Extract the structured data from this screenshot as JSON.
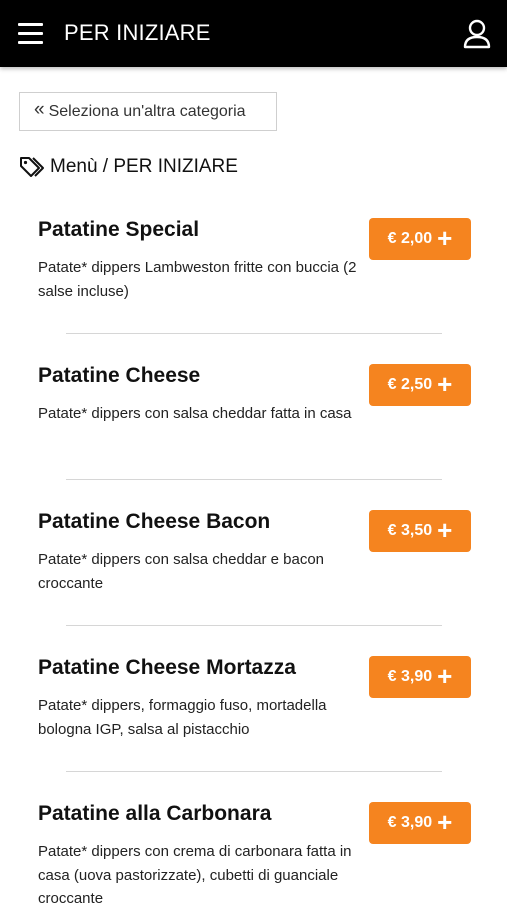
{
  "header": {
    "title": "PER INIZIARE",
    "menu_icon": "hamburger-icon",
    "user_icon": "user-icon"
  },
  "back_button": {
    "label": "Seleziona un'altra categoria",
    "icon": "double-chevron-left-icon"
  },
  "breadcrumb": {
    "icon": "tag-icon",
    "text": "Menù / PER INIZIARE"
  },
  "accent_color": "#f5841f",
  "items": [
    {
      "name": "Patatine Special",
      "price": "€ 2,00",
      "description": "Patate* dippers Lambweston fritte con buccia (2 salse incluse)"
    },
    {
      "name": "Patatine Cheese",
      "price": "€ 2,50",
      "description": "Patate* dippers con salsa cheddar fatta in casa"
    },
    {
      "name": "Patatine Cheese Bacon",
      "price": "€ 3,50",
      "description": "Patate* dippers con salsa cheddar e bacon croccante"
    },
    {
      "name": "Patatine Cheese Mortazza",
      "price": "€ 3,90",
      "description": "Patate* dippers, formaggio fuso, mortadella bologna IGP, salsa al pistacchio"
    },
    {
      "name": "Patatine alla Carbonara",
      "price": "€ 3,90",
      "description": "Patate* dippers con crema di carbonara fatta in casa (uova pastorizzate), cubetti di guanciale croccante"
    }
  ]
}
